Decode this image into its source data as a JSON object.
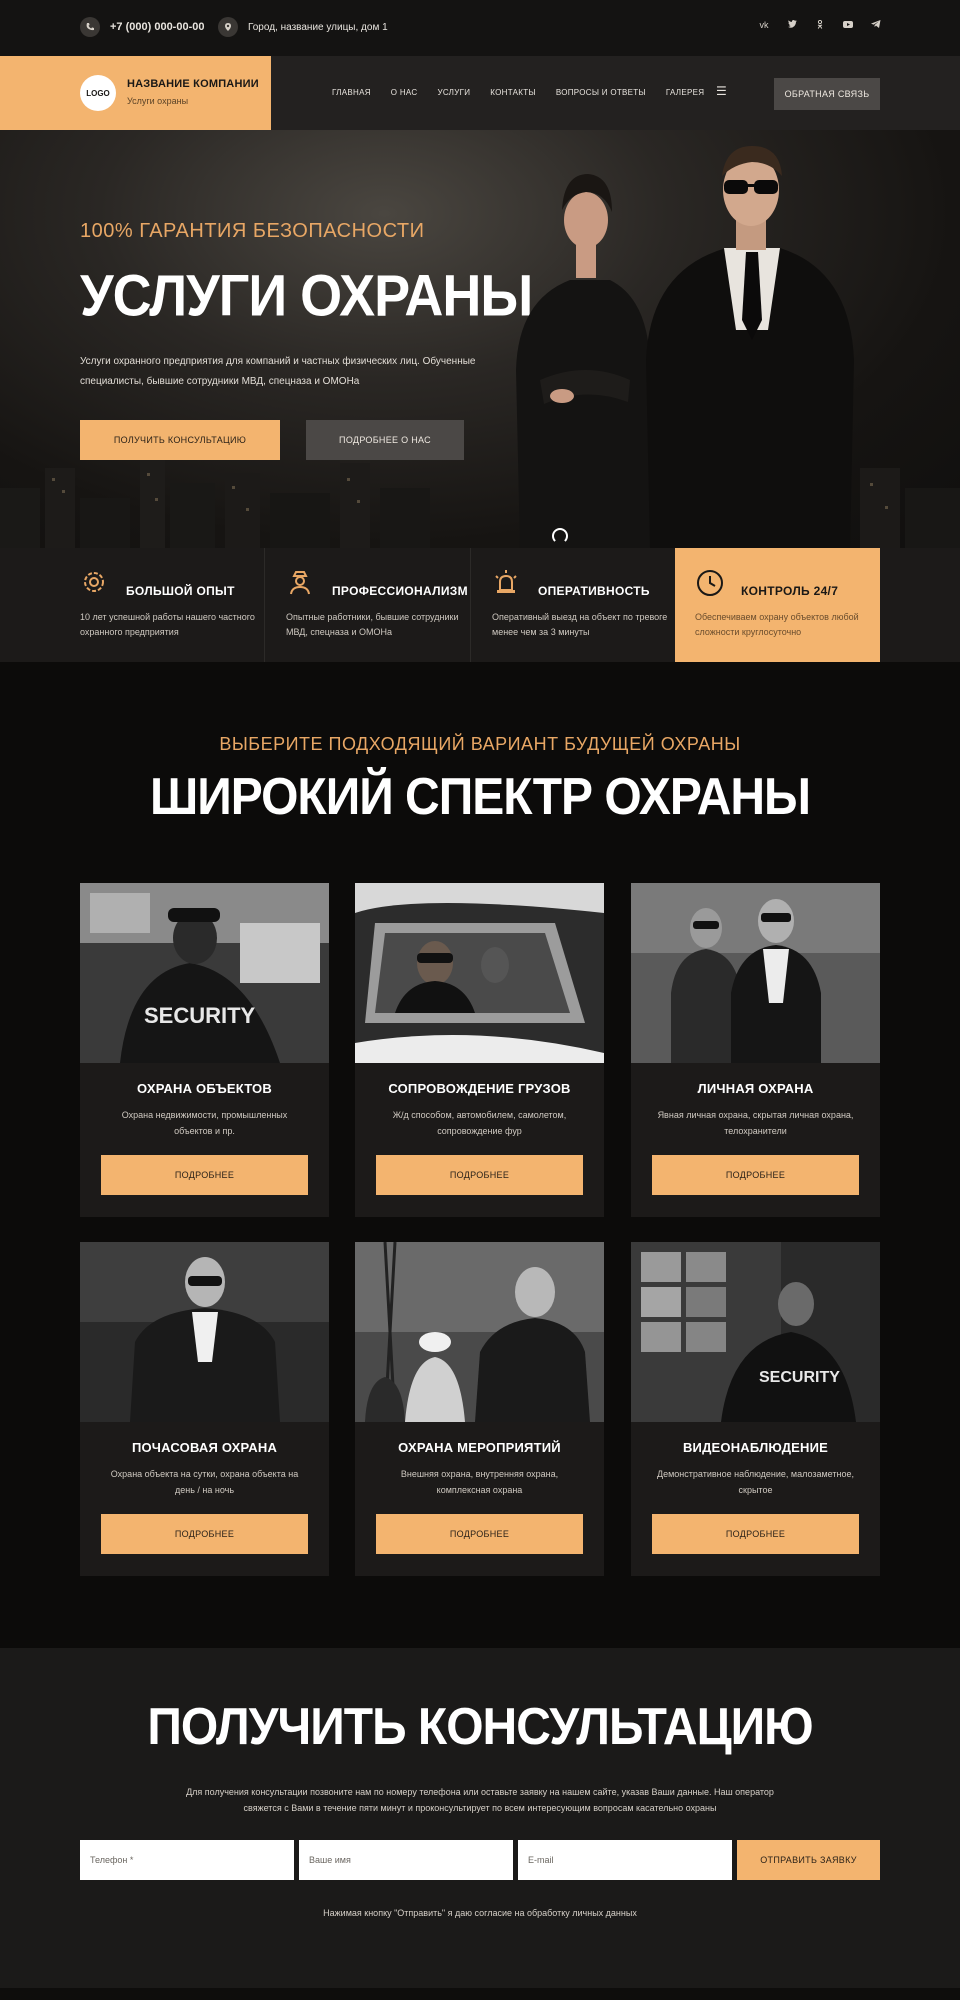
{
  "topbar": {
    "phone": "+7 (000) 000-00-00",
    "address": "Город, название улицы, дом 1",
    "phone_icon": "phone-icon",
    "address_icon": "location-pin-icon",
    "socials": [
      "vk-icon",
      "twitter-icon",
      "odnoklassniki-icon",
      "youtube-icon",
      "telegram-icon"
    ]
  },
  "header": {
    "logo": "LOGO",
    "company_name": "НАЗВАНИЕ КОМПАНИИ",
    "company_sub": "Услуги охраны",
    "nav": [
      "ГЛАВНАЯ",
      "О НАС",
      "УСЛУГИ",
      "КОНТАКТЫ",
      "ВОПРОСЫ И ОТВЕТЫ",
      "ГАЛЕРЕЯ"
    ],
    "menu_icon": "hamburger-icon",
    "feedback_button": "ОБРАТНАЯ СВЯЗЬ"
  },
  "hero": {
    "tagline": "100% ГАРАНТИЯ БЕЗОПАСНОСТИ",
    "title": "УСЛУГИ ОХРАНЫ",
    "description": "Услуги охранного предприятия для компаний и частных физических лиц. Обученные специалисты, бывшие сотрудники МВД, спецназа и ОМОНа",
    "primary_button": "ПОЛУЧИТЬ КОНСУЛЬТАЦИЮ",
    "secondary_button": "ПОДРОБНЕЕ О НАС"
  },
  "features": [
    {
      "icon": "gear-badge-icon",
      "title": "БОЛЬШОЙ ОПЫТ",
      "text": "10 лет успешной работы нашего частного охранного предприятия"
    },
    {
      "icon": "guard-icon",
      "title": "ПРОФЕССИОНАЛИЗМ",
      "text": "Опытные работники, бывшие сотрудники МВД, спецназа и ОМОНа"
    },
    {
      "icon": "siren-icon",
      "title": "ОПЕРАТИВНОСТЬ",
      "text": "Оперативный выезд на объект по тревоге менее чем за 3 минуты"
    },
    {
      "icon": "clock-icon",
      "title": "КОНТРОЛЬ 24/7",
      "text": "Обеспечиваем охрану объектов любой сложности круглосуточно"
    }
  ],
  "services": {
    "tagline": "ВЫБЕРИТЕ ПОДХОДЯЩИЙ ВАРИАНТ БУДУЩЕЙ ОХРАНЫ",
    "title": "ШИРОКИЙ СПЕКТР ОХРАНЫ",
    "button_label": "ПОДРОБНЕЕ",
    "cards": [
      {
        "title": "ОХРАНА ОБЪЕКТОВ",
        "text": "Охрана недвижимости, промышленных объектов и пр.",
        "photo_text": "SECURITY"
      },
      {
        "title": "СОПРОВОЖДЕНИЕ ГРУЗОВ",
        "text": "Ж/д способом, автомобилем, самолетом, сопровождение фур",
        "photo_text": ""
      },
      {
        "title": "ЛИЧНАЯ ОХРАНА",
        "text": "Явная личная охрана, скрытая личная охрана, телохранители",
        "photo_text": ""
      },
      {
        "title": "ПОЧАСОВАЯ ОХРАНА",
        "text": "Охрана объекта на сутки, охрана объекта на день / на ночь",
        "photo_text": ""
      },
      {
        "title": "ОХРАНА МЕРОПРИЯТИЙ",
        "text": "Внешняя охрана, внутренняя охрана, комплексная охрана",
        "photo_text": ""
      },
      {
        "title": "ВИДЕОНАБЛЮДЕНИЕ",
        "text": "Демонстративное наблюдение, малозаметное, скрытое",
        "photo_text": "SECURITY"
      }
    ]
  },
  "consult": {
    "title": "ПОЛУЧИТЬ КОНСУЛЬТАЦИЮ",
    "description": "Для получения консультации позвоните нам по номеру телефона или оставьте заявку на нашем сайте, указав Ваши данные. Наш оператор свяжется с Вами в течение пяти минут и проконсультирует по всем интересующим вопросам касательно охраны",
    "phone_placeholder": "Телефон *",
    "name_placeholder": "Ваше имя",
    "email_placeholder": "E-mail",
    "submit_button": "ОТПРАВИТЬ ЗАЯВКУ",
    "consent": "Нажимая кнопку \"Отправить\" я даю согласие на обработку личных данных"
  },
  "colors": {
    "accent": "#f3b46f",
    "accent_text": "#e8a765",
    "dark": "#1c1a19",
    "darker": "#0c0b0a",
    "secondary_button": "#4b4846"
  }
}
